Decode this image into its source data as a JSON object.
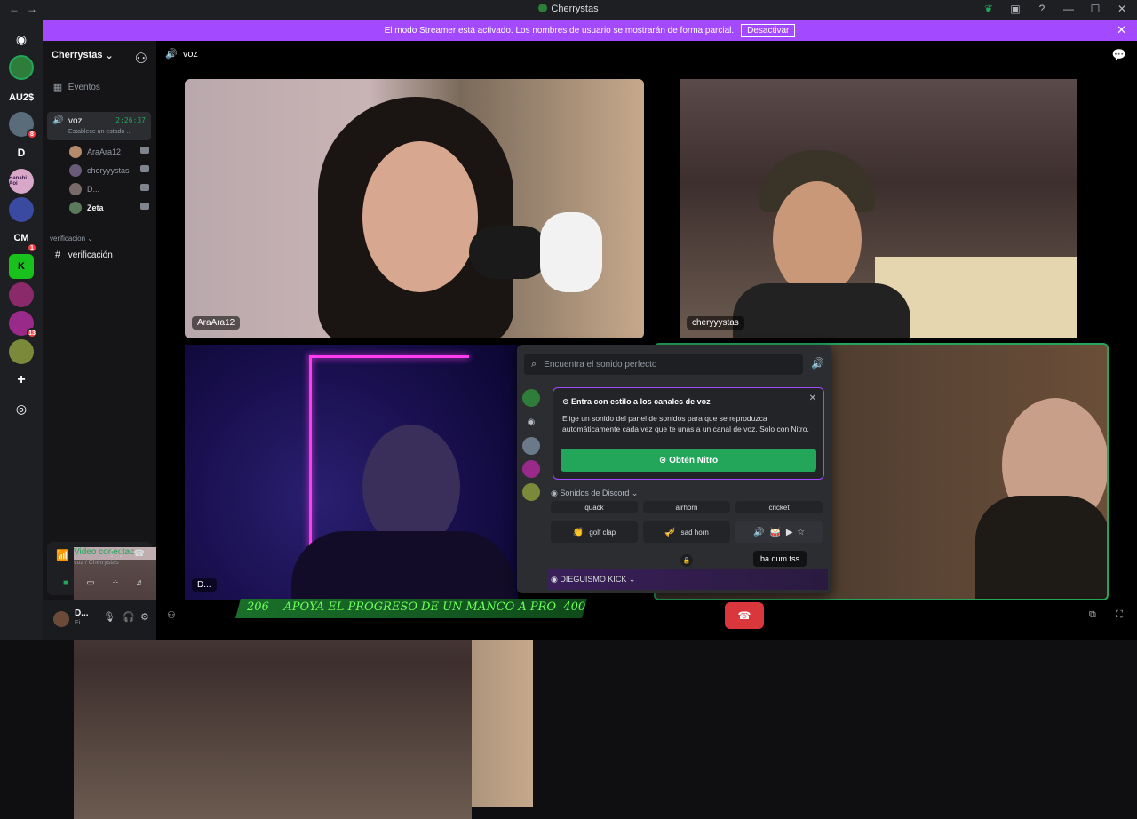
{
  "window": {
    "title": "Cherrystas"
  },
  "banner": {
    "text": "El modo Streamer está activado. Los nombres de usuario se mostrarán de forma parcial.",
    "button": "Desactivar"
  },
  "guilds": [
    {
      "label": "",
      "color": "#2f7d3a"
    },
    {
      "label": "AU2$",
      "color": "#1e1f22"
    },
    {
      "label": "",
      "color": "#5a6b7a",
      "badge": "8"
    },
    {
      "label": "D",
      "color": "#1e1f22"
    },
    {
      "label": "Hanabi Aoi",
      "color": "#d9a8c8"
    },
    {
      "label": "",
      "color": "#3a4aa0"
    },
    {
      "label": "CM",
      "color": "#1e1f22",
      "badge": "1"
    },
    {
      "label": "K",
      "color": "#18c11b"
    },
    {
      "label": "",
      "color": "#8a2a6a"
    },
    {
      "label": "",
      "color": "#9a2a8a",
      "badge": "13"
    },
    {
      "label": "",
      "color": "#7a8a3a"
    }
  ],
  "sidebar": {
    "server_name": "Cherrystas",
    "events": "Eventos",
    "voice_channel": {
      "name": "voz",
      "time": "2:26:37",
      "status": "Establece un estado ..."
    },
    "users": [
      "AraAra12",
      "cheryyystas",
      "D...",
      "Zeta"
    ],
    "category": "verificacion",
    "text_channel": "verificación",
    "voice_status": {
      "title": "Video conectac",
      "subtitle": "voz / Cherrystas"
    },
    "user": {
      "name": "D...",
      "status": "Ei"
    }
  },
  "stage": {
    "header": "voz",
    "tiles": [
      "AraAra12",
      "cheryyystas",
      "D..."
    ]
  },
  "sound_panel": {
    "search_placeholder": "Encuentra el sonido perfecto",
    "nitro_title": "Entra con estilo a los canales de voz",
    "nitro_text": "Elige un sonido del panel de sonidos para que se reproduzca automáticamente cada vez que te unas a un canal de voz. Solo con Nitro.",
    "nitro_button": "Obtén Nitro",
    "section": "Sonidos de Discord",
    "row1": [
      "quack",
      "airhorn",
      "cricket"
    ],
    "row2": [
      "golf clap",
      "sad horn",
      "ba dum tss"
    ],
    "custom_section": "DIEGUISMO KICK",
    "tooltip": "ba dum tss"
  },
  "overlay": {
    "count_left": "206",
    "message": "APOYA EL PROGRESO DE UN MANCO A PRO",
    "count_right": "400"
  }
}
